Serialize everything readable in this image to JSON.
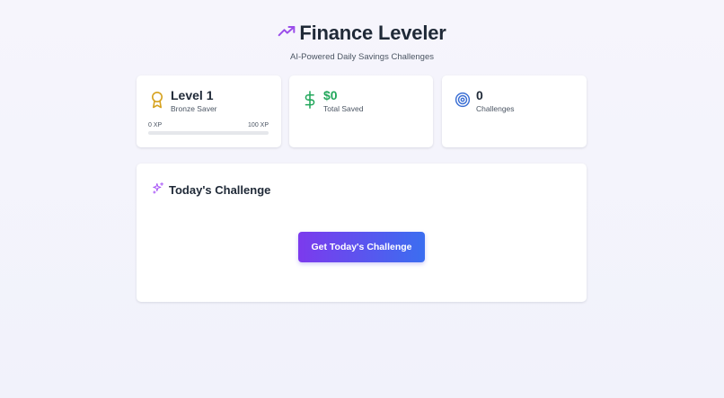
{
  "header": {
    "title": "Finance Leveler",
    "subtitle": "AI-Powered Daily Savings Challenges",
    "icon": "trending-up-icon",
    "icon_color": "#9b4dea"
  },
  "stats": {
    "level": {
      "value": "Level 1",
      "label": "Bronze Saver",
      "icon": "award-icon",
      "icon_color": "#d6a21f",
      "xp_min_label": "0 XP",
      "xp_max_label": "100 XP",
      "xp_progress_fraction": 0
    },
    "saved": {
      "value": "$0",
      "label": "Total Saved",
      "icon": "dollar-sign-icon",
      "icon_color": "#22a75b"
    },
    "challenges": {
      "value": "0",
      "label": "Challenges",
      "icon": "target-icon",
      "icon_color": "#3b6fd4"
    }
  },
  "challenge": {
    "title": "Today's Challenge",
    "icon": "sparkles-icon",
    "icon_color": "#a855f7",
    "button_label": "Get Today's Challenge"
  },
  "colors": {
    "accent_start": "#7c3aed",
    "accent_end": "#3b6ef0",
    "background": "#f4f4fb"
  }
}
